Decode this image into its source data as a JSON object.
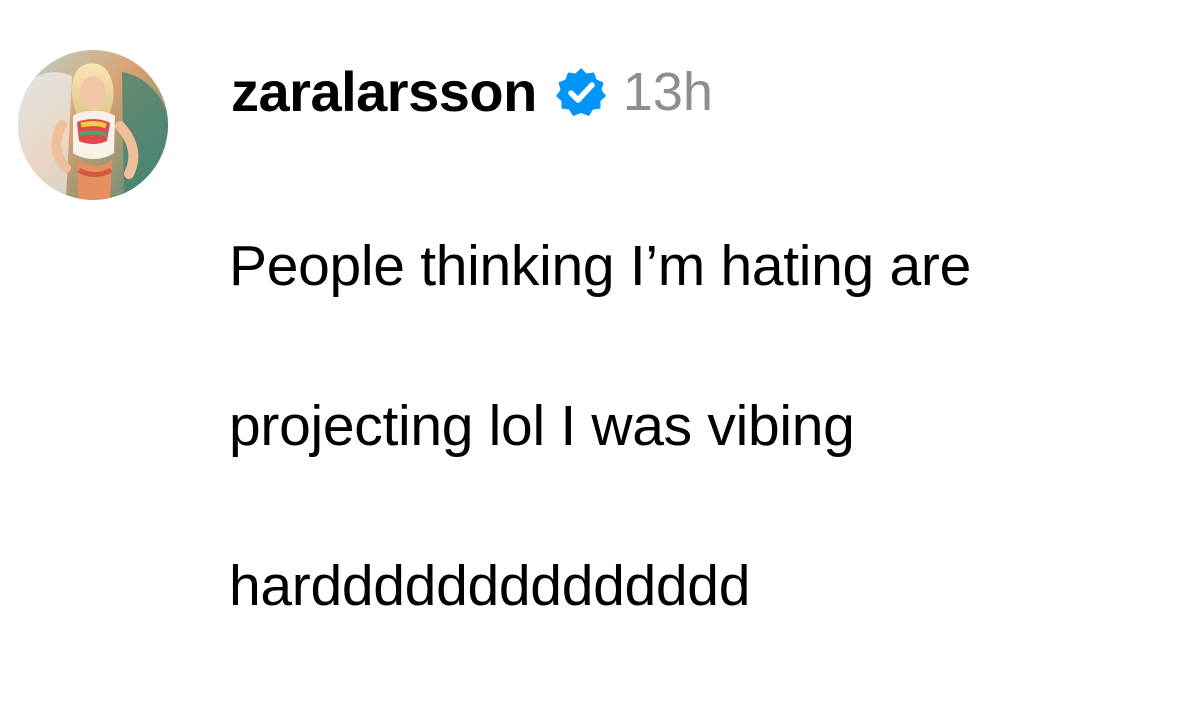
{
  "comment": {
    "username": "zaralarsson",
    "verified": true,
    "timestamp": "13h",
    "text_lines": [
      "People thinking I’m hating are",
      "projecting lol I was vibing",
      "hardddddddddddddd"
    ],
    "avatar_icon": "profile-photo",
    "verified_icon": "verified-badge-icon",
    "colors": {
      "verified_badge": "#0095f6",
      "timestamp": "#8e8e8e",
      "text": "#000000"
    }
  }
}
